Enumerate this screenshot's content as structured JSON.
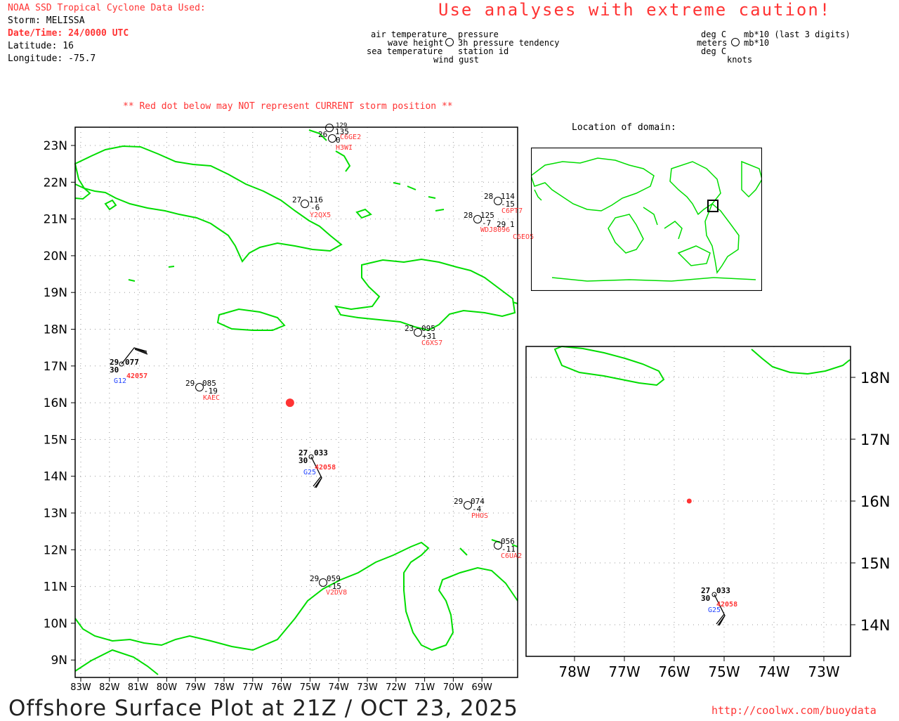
{
  "header": {
    "source": "NOAA SSD Tropical Cyclone Data Used:",
    "storm": "Storm: MELISSA",
    "datetime": "Date/Time: 24/0000 UTC",
    "latitude": "Latitude: 16",
    "longitude": "Longitude: -75.7",
    "caution": "Use analyses with extreme caution!"
  },
  "station_key": {
    "left": {
      "air_temperature": "air temperature",
      "pressure": "pressure",
      "wave_height": "wave height",
      "tendency": "3h pressure tendency",
      "sea_temperature": "sea temperature",
      "station_id": "station id",
      "wind_gust": "wind gust"
    },
    "right": {
      "deg_c_1": "deg C",
      "mb10_last3": "mb*10 (last 3 digits)",
      "meters": "meters",
      "mb10": "mb*10",
      "deg_c_2": "deg C",
      "knots": "knots"
    }
  },
  "notice": "** Red dot below may NOT represent CURRENT storm position **",
  "inset_title": "Location of domain:",
  "main_map": {
    "lat_labels": [
      "23N",
      "22N",
      "21N",
      "20N",
      "19N",
      "18N",
      "17N",
      "16N",
      "15N",
      "14N",
      "13N",
      "12N",
      "11N",
      "10N",
      "9N"
    ],
    "lon_labels": [
      "83W",
      "82W",
      "81W",
      "80W",
      "79W",
      "78W",
      "77W",
      "76W",
      "75W",
      "74W",
      "73W",
      "72W",
      "71W",
      "70W",
      "69W"
    ],
    "storm_position": {
      "lat": 16.0,
      "lon": -75.7
    },
    "stations": [
      {
        "id": "Y2QX5",
        "air_temp": "27",
        "pressure": "116",
        "tendency": "-6"
      },
      {
        "id": "C6PT7",
        "air_temp": "28",
        "pressure": "114",
        "tendency": "-15"
      },
      {
        "id": "WDJ8096",
        "air_temp": "28",
        "pressure": "125",
        "tendency": "-7"
      },
      {
        "id": "C6EO5",
        "air_temp": "29",
        "pressure": "1"
      },
      {
        "id": "C6XS7",
        "air_temp": "23",
        "pressure": "095",
        "tendency": "+31"
      },
      {
        "id": "KAEC",
        "air_temp": "29",
        "pressure": "085",
        "tendency": "-19"
      },
      {
        "id": "42057",
        "air_temp": "29",
        "sea_temp": "30",
        "pressure": "077",
        "gust": "G12"
      },
      {
        "id": "42058",
        "air_temp": "27",
        "sea_temp": "30",
        "pressure": "033",
        "gust": "G25"
      },
      {
        "id": "PHOS",
        "air_temp": "29",
        "pressure": "074",
        "tendency": "-4"
      },
      {
        "id": "C6UA2",
        "pressure": "056",
        "tendency": "-11"
      },
      {
        "id": "V2DV8",
        "air_temp": "29",
        "pressure": "059",
        "tendency": "-15"
      },
      {
        "id": "H3WI",
        "air_temp": "26",
        "pressure": "135",
        "tendency": "0"
      },
      {
        "id": "C6GE2"
      },
      {
        "id": "unlabeled",
        "air_temp": "24",
        "pressure": "129"
      }
    ]
  },
  "zoom_map": {
    "lat_labels": [
      "18N",
      "17N",
      "16N",
      "15N",
      "14N"
    ],
    "lon_labels": [
      "78W",
      "77W",
      "76W",
      "75W",
      "74W",
      "73W"
    ],
    "station": {
      "id": "42058",
      "air_temp": "27",
      "sea_temp": "30",
      "pressure": "033",
      "gust": "G25"
    }
  },
  "footer": {
    "title": "Offshore Surface Plot at 21Z / OCT 23, 2025",
    "url": "http://coolwx.com/buoydata"
  },
  "colors": {
    "land": "#00dd00",
    "storm": "#ff3333",
    "station_id": "#ff3333",
    "gust": "#2244ff",
    "frame": "#000000",
    "grid": "#999999"
  }
}
